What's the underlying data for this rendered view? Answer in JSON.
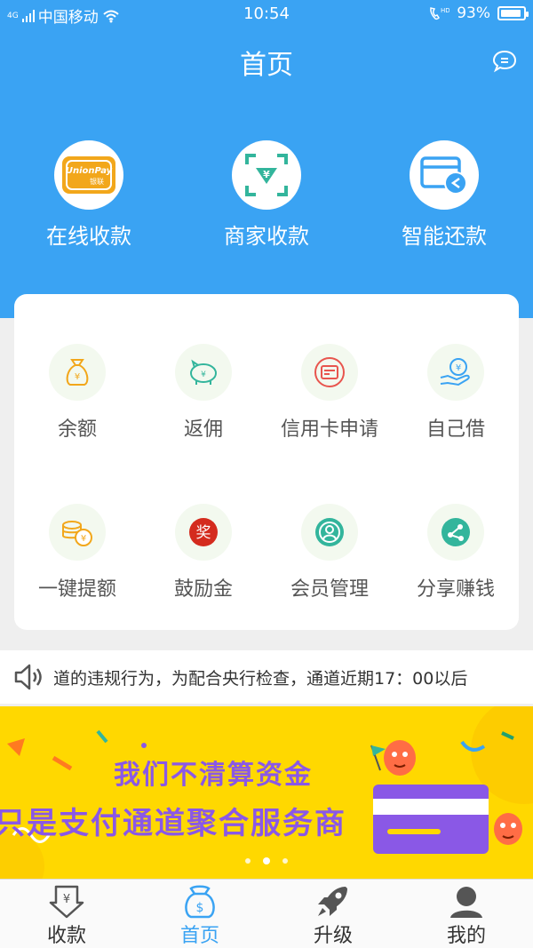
{
  "status_bar": {
    "network": "4G",
    "carrier": "中国移动",
    "time": "10:54",
    "call_indicator": "HD",
    "battery_percent": "93%",
    "battery_level": 0.93
  },
  "header": {
    "title": "首页",
    "chat_icon": "chat-bubble-icon"
  },
  "top_actions": [
    {
      "label": "在线收款",
      "icon": "unionpay-card-icon",
      "card_text": "UnionPay",
      "card_subtext": "银联"
    },
    {
      "label": "商家收款",
      "icon": "qr-scan-yen-icon"
    },
    {
      "label": "智能还款",
      "icon": "card-repay-icon"
    }
  ],
  "grid_items": [
    {
      "label": "余额",
      "icon": "money-bag-icon"
    },
    {
      "label": "返佣",
      "icon": "piggy-bank-icon"
    },
    {
      "label": "信用卡申请",
      "icon": "credit-card-icon"
    },
    {
      "label": "自己借",
      "icon": "hand-coin-icon"
    },
    {
      "label": "一键提额",
      "icon": "coin-stack-icon"
    },
    {
      "label": "鼓励金",
      "icon": "reward-badge-icon",
      "badge_text": "奖"
    },
    {
      "label": "会员管理",
      "icon": "member-icon"
    },
    {
      "label": "分享赚钱",
      "icon": "share-icon"
    }
  ],
  "notice": {
    "text": "道的违规行为，为配合央行检查，通道近期17：00以后"
  },
  "banner": {
    "line1": "我们不清算资金",
    "line2": "只是支付通道聚合服务商",
    "slide_count": 3,
    "active_slide": 2
  },
  "tabbar": [
    {
      "label": "收款",
      "icon": "receive-money-icon",
      "active": false
    },
    {
      "label": "首页",
      "icon": "home-moneybag-icon",
      "active": true
    },
    {
      "label": "升级",
      "icon": "rocket-icon",
      "active": false
    },
    {
      "label": "我的",
      "icon": "profile-icon",
      "active": false
    }
  ],
  "colors": {
    "primary": "#3aa3f3",
    "banner_bg": "#ffd800",
    "banner_text": "#8a58e6",
    "icon_orange": "#f2a71b",
    "icon_green": "#33b59c",
    "icon_red": "#e8554e",
    "icon_blue": "#3aa3f3"
  }
}
